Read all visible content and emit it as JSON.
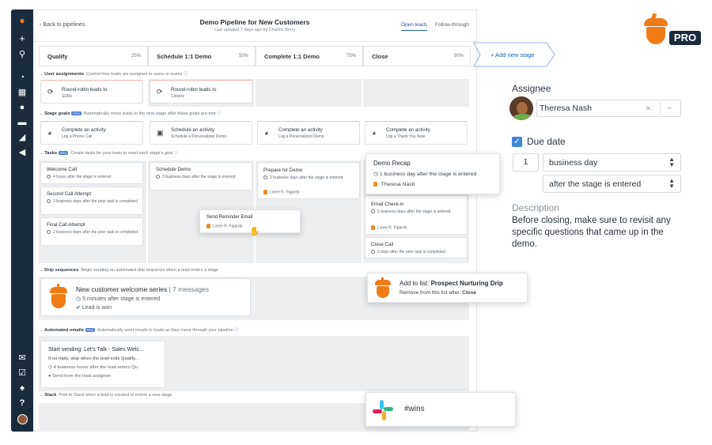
{
  "colors": {
    "sidebar": "#1a2b3e",
    "accent": "#f07b17",
    "link": "#1e5fae",
    "checkbox": "#3f86d6"
  },
  "sidebar": {
    "icons": [
      "acorn-logo-icon",
      "plus-icon",
      "search-icon",
      "gauge-icon",
      "building-icon",
      "person-icon",
      "ticket-icon",
      "chart-icon",
      "megaphone-icon",
      "mail-icon",
      "checklist-icon",
      "bell-icon",
      "help-icon",
      "avatar"
    ]
  },
  "header": {
    "back": "Back to pipelines",
    "title": "Demo Pipeline for New Customers",
    "subtitle": "Last updated 7 days ago by Charles Berry",
    "tabs": [
      "Open leads",
      "Follow-through"
    ]
  },
  "stages": [
    {
      "name": "Qualify",
      "pct": "25%"
    },
    {
      "name": "Schedule 1:1 Demo",
      "pct": "50%"
    },
    {
      "name": "Complete 1:1 Demo",
      "pct": "75%"
    },
    {
      "name": "Close",
      "pct": "90%"
    }
  ],
  "add_stage": "+ Add new stage",
  "sections": {
    "assign": {
      "title": "User assignments",
      "desc": "Control how leads are assigned to users or teams"
    },
    "goals": {
      "title": "Stage goals",
      "badge": "PRO",
      "desc": "Automatically move leads to the next stage after these goals are met"
    },
    "tasks": {
      "title": "Tasks",
      "badge": "PRO",
      "desc": "Create tasks for your team to meet each stage's goal"
    },
    "drip": {
      "title": "Drip sequences",
      "desc": "Begin sending an automated drip sequence when a lead enters a stage"
    },
    "emails": {
      "title": "Automated emails",
      "badge": "PRO",
      "desc": "Automatically send emails to leads as they move through your pipeline"
    },
    "slack": {
      "title": "Slack",
      "desc": "Post to Slack when a lead is created or enters a new stage"
    }
  },
  "assign_cards": [
    {
      "t": "Round-robin leads to",
      "s": "SDRs"
    },
    {
      "t": "Round-robin leads to",
      "s": "Closers"
    }
  ],
  "goal_cards": [
    {
      "t": "Complete an activity",
      "s": "Log a Phone Call"
    },
    {
      "t": "Schedule an activity",
      "s": "Schedule a Personalized Demo"
    },
    {
      "t": "Complete an activity",
      "s": "Log a Personalized Demo"
    },
    {
      "t": "Complete an activity",
      "s": "Log a Thank You Note"
    }
  ],
  "tasks": {
    "c1": [
      {
        "t": "Welcome Call",
        "s": "4 hours after the stage is entered"
      },
      {
        "t": "Second Call Attempt",
        "s": "2 business days after the prior task is completed"
      },
      {
        "t": "Final Call Attempt",
        "s": "2 business days after the prior task is completed"
      }
    ],
    "c2": [
      {
        "t": "Schedule Demo",
        "s": "3 business days after the stage is entered"
      }
    ],
    "c3": [
      {
        "t": "Prepare for Demo",
        "s": "2 business days after the stage is entered",
        "a": "Loree R. Fajardo"
      }
    ],
    "c4": [
      {
        "t": "Email Check-in",
        "s": "5 business days after the stage is entered",
        "a": "Loree R. Fajardo"
      },
      {
        "t": "Close Call",
        "s": "2 days after the prior task is completed"
      }
    ],
    "dragging": {
      "t": "Send Reminder Email",
      "a": "Loree R. Fajardo"
    }
  },
  "demo_recap": {
    "title": "Demo Recap",
    "s": "1 business day after the stage is entered",
    "a": "Theresa Nash"
  },
  "drip_card": {
    "title": "New customer welcome series",
    "count": "| 7 messages",
    "s1": "5 minutes after stage is entered",
    "s2": "Lead is won"
  },
  "drip_float": {
    "prefix": "Add to list:",
    "list": "Prospect Nurturing Drip",
    "remove": "Remove from this list after:",
    "after": "Close"
  },
  "email_card": {
    "title": "Start sending: Let's Talk - Sales Welc...",
    "l1": "If no reply, stop when the lead exits Qualify...",
    "l2": "4 business hours after the lead enters Qu",
    "l3": "Send from the lead assignee"
  },
  "slack_float": {
    "channel": "#wins"
  },
  "pro_badge": "PRO",
  "right": {
    "assignee_label": "Assignee",
    "assignee": "Theresa Nash",
    "due_label": "Due date",
    "due_num": "1",
    "due_unit": "business day",
    "due_when": "after the stage is entered",
    "desc_label": "Description",
    "desc": "Before closing, make sure to revisit any specific questions that came up in the demo."
  }
}
